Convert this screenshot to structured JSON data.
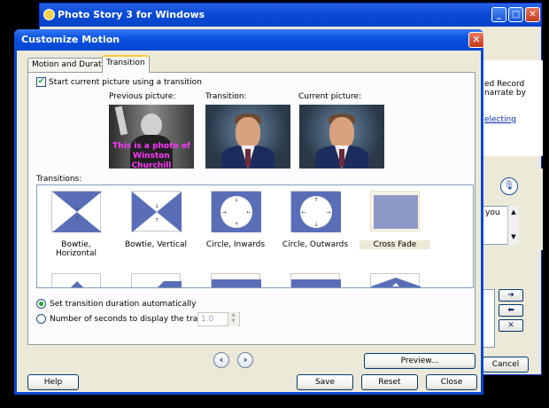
{
  "background_window": {
    "title": "Photo Story 3 for Windows",
    "min_btn": "_",
    "max_btn": "□",
    "close_btn": "✕",
    "right_texts": [
      "ed Record",
      "narrate by",
      "electing"
    ],
    "narration_text": "you",
    "scroll_up": "▲",
    "scroll_down": "▼",
    "mic_icon": "🎙",
    "arrow_right": "➜",
    "arrow_left": "⬅",
    "arrow_remove": "✕",
    "cancel_label": "Cancel"
  },
  "dialog": {
    "title": "Customize Motion",
    "close_btn": "✕",
    "tabs": [
      {
        "label": "Motion and Duration",
        "active": false
      },
      {
        "label": "Transition",
        "active": true
      }
    ],
    "start_checkbox": {
      "label": "Start current picture using a transition",
      "checked": true,
      "mark": "✔"
    },
    "previews": {
      "previous_label": "Previous picture:",
      "transition_label": "Transition:",
      "current_label": "Current picture:",
      "previous_overlay_text": "This is a photo of Winston Churchill"
    },
    "transitions_label": "Transitions:",
    "transitions": [
      {
        "name": "Bowtie, Horizontal",
        "selected": false
      },
      {
        "name": "Bowtie, Vertical",
        "selected": false
      },
      {
        "name": "Circle, Inwards",
        "selected": false
      },
      {
        "name": "Circle, Outwards",
        "selected": false
      },
      {
        "name": "Cross Fade",
        "selected": true
      }
    ],
    "scroll_up": "▲",
    "scroll_down": "▼",
    "duration": {
      "auto_label": "Set transition duration automatically",
      "auto_selected": true,
      "seconds_label": "Number of seconds to display the transition",
      "seconds_value": "1.0",
      "spin_up": "▲",
      "spin_down": "▼"
    },
    "nav_prev": "‹",
    "nav_next": "›",
    "buttons": {
      "preview": "Preview...",
      "help": "Help",
      "save": "Save",
      "reset": "Reset",
      "close": "Close"
    },
    "colors": {
      "icon_blue": "#5a6eb8",
      "titlebar_blue": "#0a54e3"
    }
  }
}
